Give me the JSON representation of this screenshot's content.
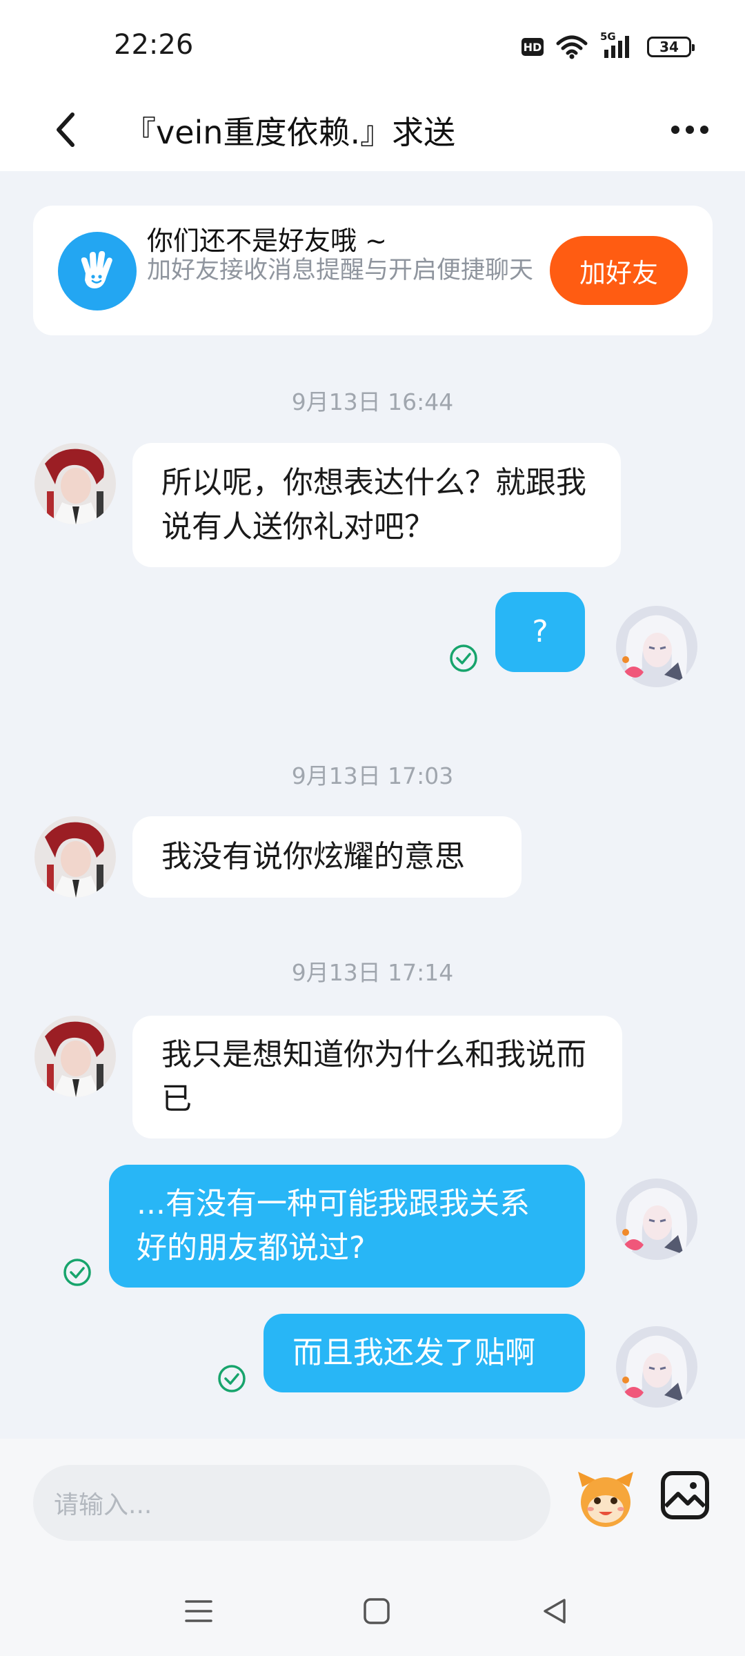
{
  "status_bar": {
    "time": "22:26",
    "hd_label": "HD",
    "network_label": "5G",
    "battery": "34",
    "icons": [
      "hd-icon",
      "wifi-icon",
      "signal-5g-icon",
      "battery-icon"
    ]
  },
  "header": {
    "title": "『vein重度依赖.』求送",
    "back_icon": "chevron-left-icon",
    "more_icon": "more-dots-icon"
  },
  "friend_banner": {
    "title": "你们还不是好友哦 ~",
    "subtitle": "加好友接收消息提醒与开启便捷聊天",
    "button_label": "加好友",
    "icon": "wave-hand-icon",
    "accent": "#ff5c12"
  },
  "chat": {
    "timestamps": [
      "9月13日 16:44",
      "9月13日 17:03",
      "9月13日 17:14"
    ],
    "messages": [
      {
        "side": "in",
        "text": "所以呢，你想表达什么？就跟我说有人送你礼对吧？"
      },
      {
        "side": "out",
        "text": "?",
        "read": true
      },
      {
        "side": "in",
        "text": "我没有说你炫耀的意思"
      },
      {
        "side": "in",
        "text": "我只是想知道你为什么和我说而已"
      },
      {
        "side": "out",
        "text": "...有没有一种可能我跟我关系好的朋友都说过?",
        "read": true
      },
      {
        "side": "out",
        "text": "而且我还发了贴啊",
        "read": true
      }
    ],
    "bubble_out_color": "#28b6f6",
    "read_icon": "check-circle-icon"
  },
  "input": {
    "placeholder": "请输入...",
    "emoji_icon": "emoji-mascot-icon",
    "image_icon": "image-icon"
  },
  "nav": {
    "icons": [
      "menu-icon",
      "home-square-icon",
      "back-triangle-icon"
    ]
  }
}
